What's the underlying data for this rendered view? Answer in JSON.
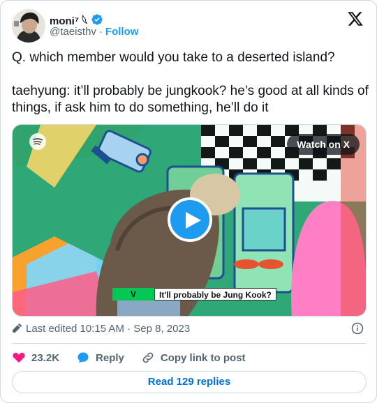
{
  "author": {
    "name": "moni⁷ 𓆩",
    "handle": "@taeisthv",
    "separator": "·",
    "follow_label": "Follow",
    "verified_color": "#1d9bf0"
  },
  "tweet": {
    "text": "Q. which member would you take to a deserted island?\n\ntaehyung: it’ll probably be jungkook? he’s good at all kinds of things, if ask him to do something, he’ll do it"
  },
  "media": {
    "watch_label": "Watch on X",
    "caption_speaker": "V",
    "caption_text": "It'll probably be Jung Kook?"
  },
  "meta": {
    "timestamp": "Last edited 10:15 AM · Sep 8, 2023"
  },
  "actions": {
    "likes": "23.2K",
    "reply_label": "Reply",
    "copy_label": "Copy link to post"
  },
  "footer": {
    "read_replies_label": "Read 129 replies"
  },
  "colors": {
    "accent": "#1d9bf0",
    "like": "#f91880",
    "link": "#006fd6"
  }
}
